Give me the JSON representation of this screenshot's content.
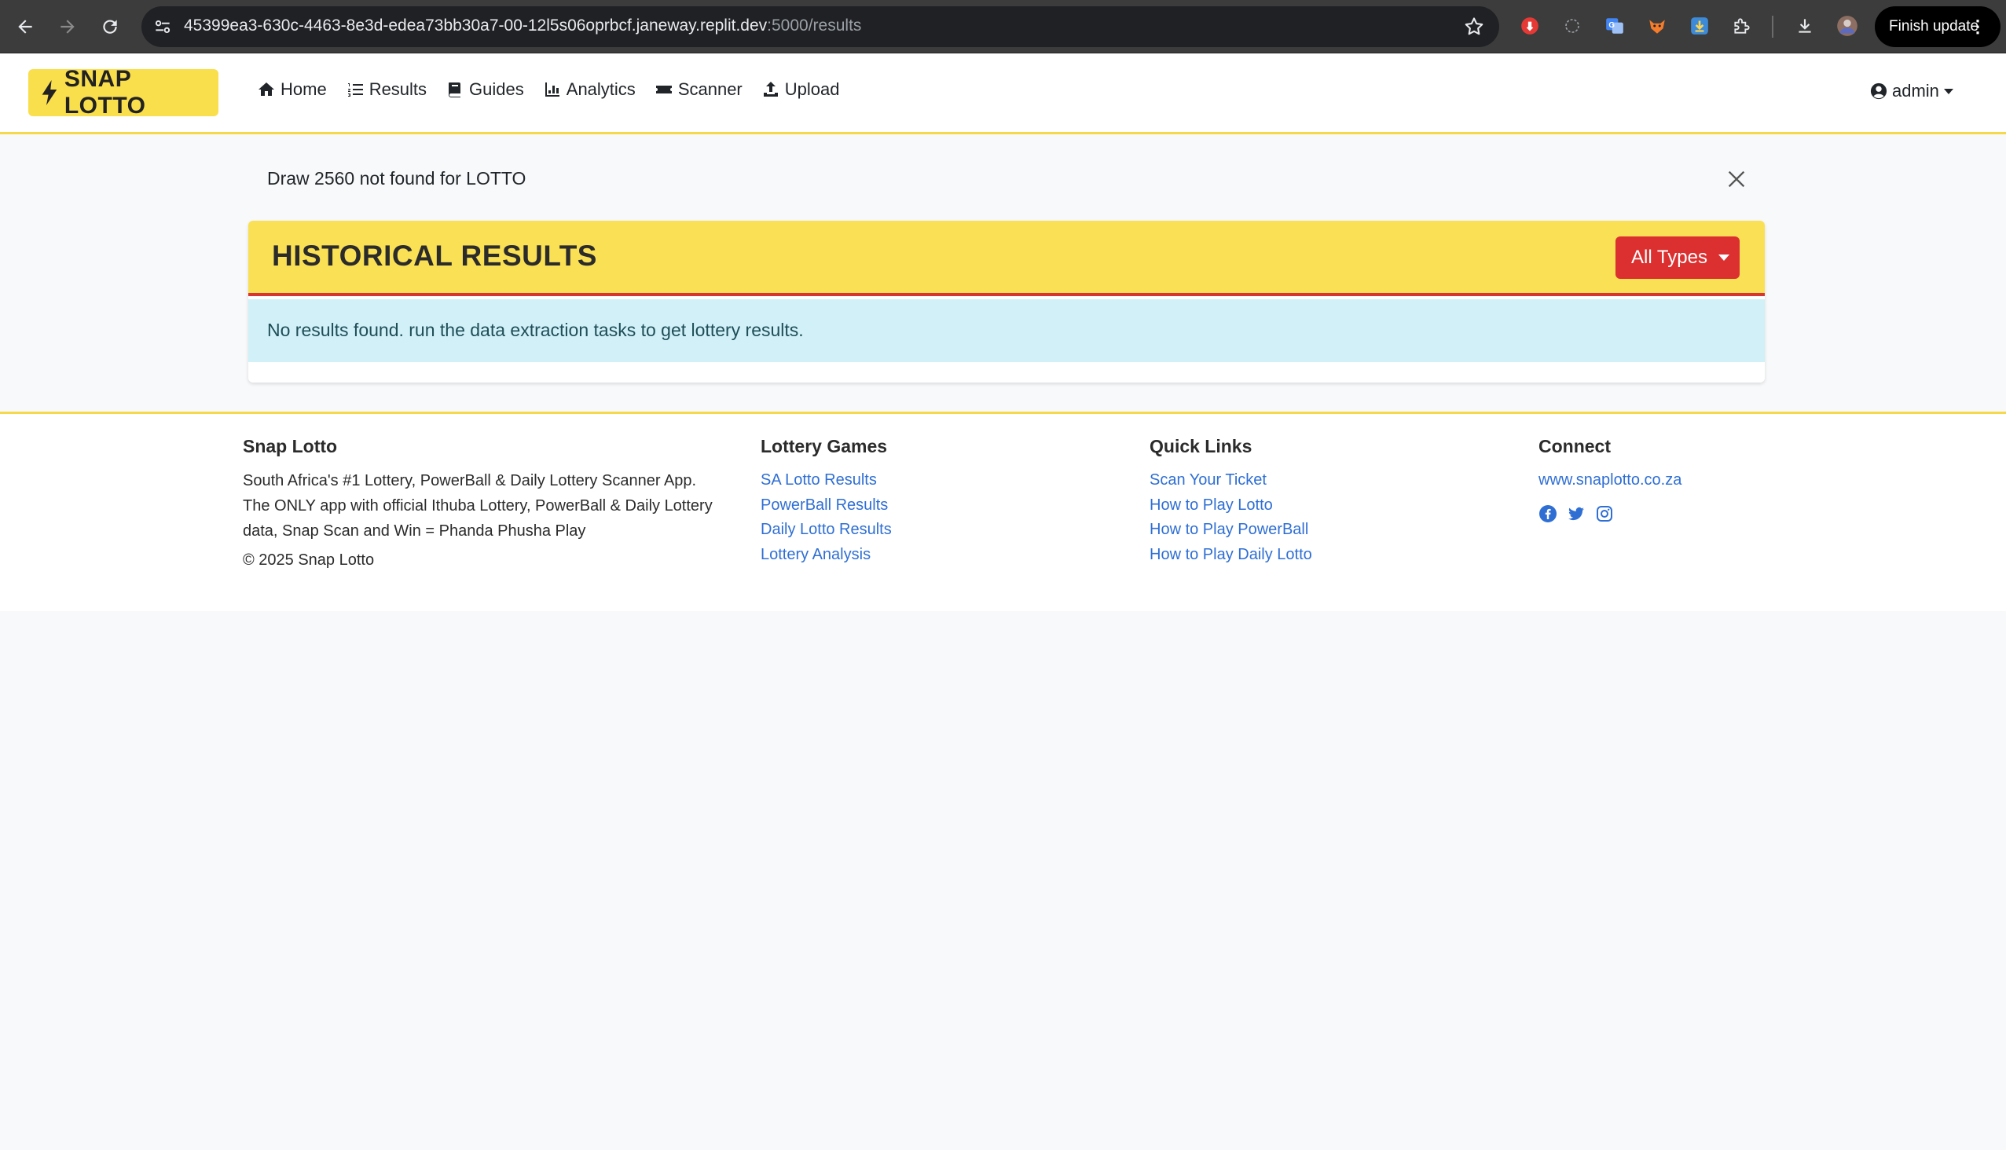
{
  "browser": {
    "url_main": "45399ea3-630c-4463-8e3d-edea73bb30a7-00-12l5s06oprbcf.janeway.replit.dev",
    "url_dim": ":5000/results",
    "finish_update": "Finish update"
  },
  "navbar": {
    "brand": "SNAP LOTTO",
    "links": [
      "Home",
      "Results",
      "Guides",
      "Analytics",
      "Scanner",
      "Upload"
    ],
    "user": "admin"
  },
  "alert": {
    "message": "Draw 2560 not found for LOTTO"
  },
  "card": {
    "title": "HISTORICAL RESULTS",
    "filter_label": "All Types",
    "info": "No results found. run the data extraction tasks to get lottery results."
  },
  "footer": {
    "about": {
      "heading": "Snap Lotto",
      "description": "South Africa's #1 Lottery, PowerBall & Daily Lottery Scanner App. The ONLY app with official Ithuba Lottery, PowerBall & Daily Lottery data, Snap Scan and Win = Phanda Phusha Play",
      "copyright": "© 2025 Snap Lotto"
    },
    "games": {
      "heading": "Lottery Games",
      "links": [
        "SA Lotto Results",
        "PowerBall Results",
        "Daily Lotto Results",
        "Lottery Analysis"
      ]
    },
    "quick": {
      "heading": "Quick Links",
      "links": [
        "Scan Your Ticket",
        "How to Play Lotto",
        "How to Play PowerBall",
        "How to Play Daily Lotto"
      ]
    },
    "connect": {
      "heading": "Connect",
      "website": "www.snaplotto.co.za",
      "social": [
        "facebook-icon",
        "twitter-icon",
        "instagram-icon"
      ]
    }
  },
  "colors": {
    "brand_yellow": "#fadf4c",
    "accent_red": "#dc3030",
    "info_bg": "#d1f0f8",
    "link_blue": "#2f6fd4"
  }
}
